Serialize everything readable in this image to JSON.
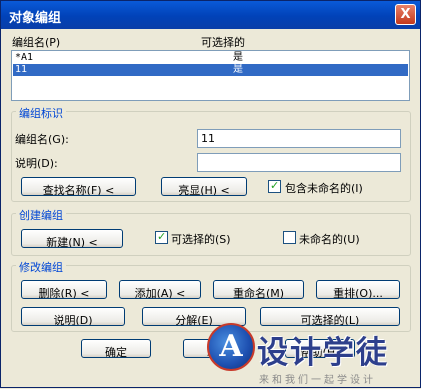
{
  "window": {
    "title": "对象编组",
    "close_glyph": "X"
  },
  "list": {
    "col_name": "编组名(P)",
    "col_selectable": "可选择的",
    "rows": [
      {
        "name": "*A1",
        "selectable": "是"
      },
      {
        "name": "11",
        "selectable": "是"
      }
    ]
  },
  "identify": {
    "title": "编组标识",
    "name_label": "编组名(G):",
    "name_value": "11",
    "desc_label": "说明(D):",
    "desc_value": "",
    "find_button": "查找名称(F) <",
    "highlight_button": "亮显(H) <",
    "include_unnamed": "包含未命名的(I)"
  },
  "create": {
    "title": "创建编组",
    "new_button": "新建(N) <",
    "selectable": "可选择的(S)",
    "unnamed": "未命名的(U)"
  },
  "modify": {
    "title": "修改编组",
    "remove_button": "删除(R) <",
    "add_button": "添加(A) <",
    "rename_button": "重命名(M)",
    "reorder_button": "重排(O)...",
    "description_button": "说明(D)",
    "explode_button": "分解(E)",
    "selectable_button": "可选择的(L)"
  },
  "footer": {
    "ok_button": "确定",
    "cancel_button": "取消",
    "help_button": "帮助(H)"
  },
  "watermark": {
    "logo_letter": "A",
    "title": "设计学徒",
    "subtitle": "来和我们一起学设计"
  }
}
